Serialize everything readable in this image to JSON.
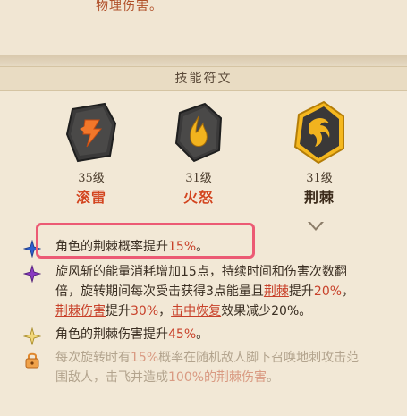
{
  "header": {
    "prev_text": "物理伤害。"
  },
  "section": {
    "title": "技能符文"
  },
  "runes": [
    {
      "level": "35级",
      "name": "滚雷",
      "icon": "lightning-rune-icon",
      "selected": false
    },
    {
      "level": "31级",
      "name": "火怒",
      "icon": "fire-rune-icon",
      "selected": false
    },
    {
      "level": "31级",
      "name": "荆棘",
      "icon": "thorn-rune-icon",
      "selected": true
    }
  ],
  "effects": [
    {
      "icon": "blue-star-icon",
      "pre": "角色的荆棘概率提升",
      "val": "15%",
      "post": "。"
    },
    {
      "icon": "purple-star-icon",
      "line1": "旋风斩的能量消耗增加15点，持续时间和伤害次数翻",
      "line2_pre": "倍，旋转期间每次受击获得3点能量且",
      "line2_link": "荆棘",
      "line2_mid": "提升",
      "line2_val": "20%",
      "line2_post": "，",
      "line3_link1": "荆棘伤害",
      "line3_mid1": "提升",
      "line3_val": "30%",
      "line3_mid2": "，",
      "line3_link2": "击中恢复",
      "line3_post": "效果减少20%。"
    },
    {
      "icon": "gold-star-icon",
      "pre": "角色的荆棘伤害提升",
      "val": "45%",
      "post": "。"
    },
    {
      "icon": "lock-icon",
      "line1_pre": "每次旋转时有",
      "line1_val": "15%",
      "line1_post": "概率在随机敌人脚下召唤地刺攻击范",
      "line2_pre": "围敌人，击飞并造成",
      "line2_val": "100%",
      "line2_link": "的荆棘伤害",
      "line2_post": "。"
    }
  ],
  "colors": {
    "accent_red": "#c8412a",
    "highlight": "#ec5a74",
    "gold": "#f2b31e"
  }
}
